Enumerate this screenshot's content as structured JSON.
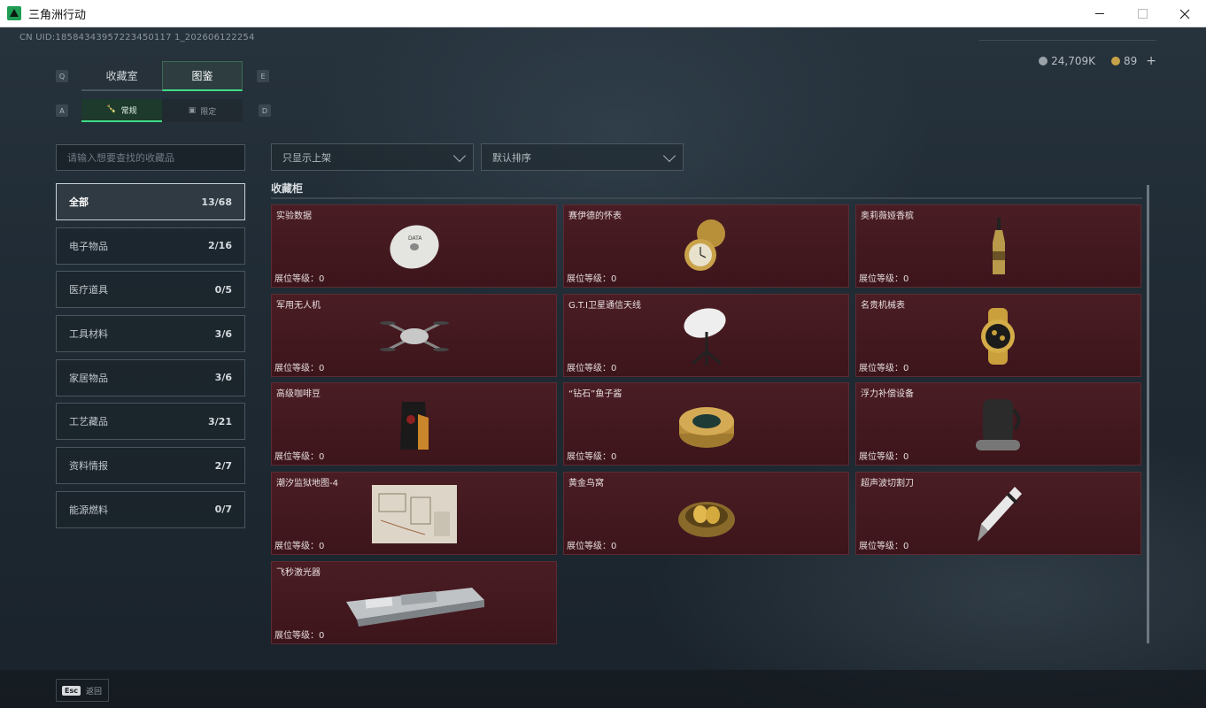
{
  "window": {
    "title": "三角洲行动"
  },
  "header": {
    "uid": "CN UID:18584343957223450117 1_202606122254",
    "currency": [
      {
        "icon": "silver-coin-icon",
        "value": "24,709K"
      },
      {
        "icon": "gold-coin-icon",
        "value": "89"
      }
    ],
    "add_label": "+"
  },
  "keys": {
    "prev_tab": "Q",
    "next_tab": "E",
    "prev_sub": "A",
    "next_sub": "D"
  },
  "tabs": [
    {
      "label": "收藏室",
      "active": false
    },
    {
      "label": "图鉴",
      "active": true
    }
  ],
  "subtabs": [
    {
      "label": "常规",
      "active": true
    },
    {
      "label": "限定",
      "active": false
    }
  ],
  "search": {
    "placeholder": "请输入想要查找的收藏品"
  },
  "filters": [
    {
      "label": "只显示上架"
    },
    {
      "label": "默认排序"
    }
  ],
  "categories": [
    {
      "label": "全部",
      "count": "13/68",
      "active": true
    },
    {
      "label": "电子物品",
      "count": "2/16"
    },
    {
      "label": "医疗道具",
      "count": "0/5"
    },
    {
      "label": "工具材料",
      "count": "3/6"
    },
    {
      "label": "家居物品",
      "count": "3/6"
    },
    {
      "label": "工艺藏品",
      "count": "3/21"
    },
    {
      "label": "资料情报",
      "count": "2/7"
    },
    {
      "label": "能源燃料",
      "count": "0/7"
    }
  ],
  "section": {
    "title": "收藏柜"
  },
  "items": [
    {
      "name": "实验数据",
      "level": "展位等级：0",
      "icon": "disc-icon"
    },
    {
      "name": "赛伊德的怀表",
      "level": "展位等级：0",
      "icon": "pocket-watch-icon"
    },
    {
      "name": "奥莉薇娅香槟",
      "level": "展位等级：0",
      "icon": "champagne-icon"
    },
    {
      "name": "军用无人机",
      "level": "展位等级：0",
      "icon": "drone-icon"
    },
    {
      "name": "G.T.I卫星通信天线",
      "level": "展位等级：0",
      "icon": "satellite-dish-icon"
    },
    {
      "name": "名贵机械表",
      "level": "展位等级：0",
      "icon": "wristwatch-icon"
    },
    {
      "name": "高级咖啡豆",
      "level": "展位等级：0",
      "icon": "coffee-bag-icon"
    },
    {
      "name": "“钻石”鱼子酱",
      "level": "展位等级：0",
      "icon": "caviar-tin-icon"
    },
    {
      "name": "浮力补偿设备",
      "level": "展位等级：0",
      "icon": "bcd-icon"
    },
    {
      "name": "潮汐监狱地图-4",
      "level": "展位等级：0",
      "icon": "map-icon"
    },
    {
      "name": "黄金鸟窝",
      "level": "展位等级：0",
      "icon": "golden-nest-icon"
    },
    {
      "name": "超声波切割刀",
      "level": "展位等级：0",
      "icon": "ultrasonic-knife-icon"
    },
    {
      "name": "飞秒激光器",
      "level": "展位等级：0",
      "icon": "laser-device-icon"
    }
  ],
  "footer": {
    "esc_key": "Esc",
    "back_label": "返回"
  }
}
